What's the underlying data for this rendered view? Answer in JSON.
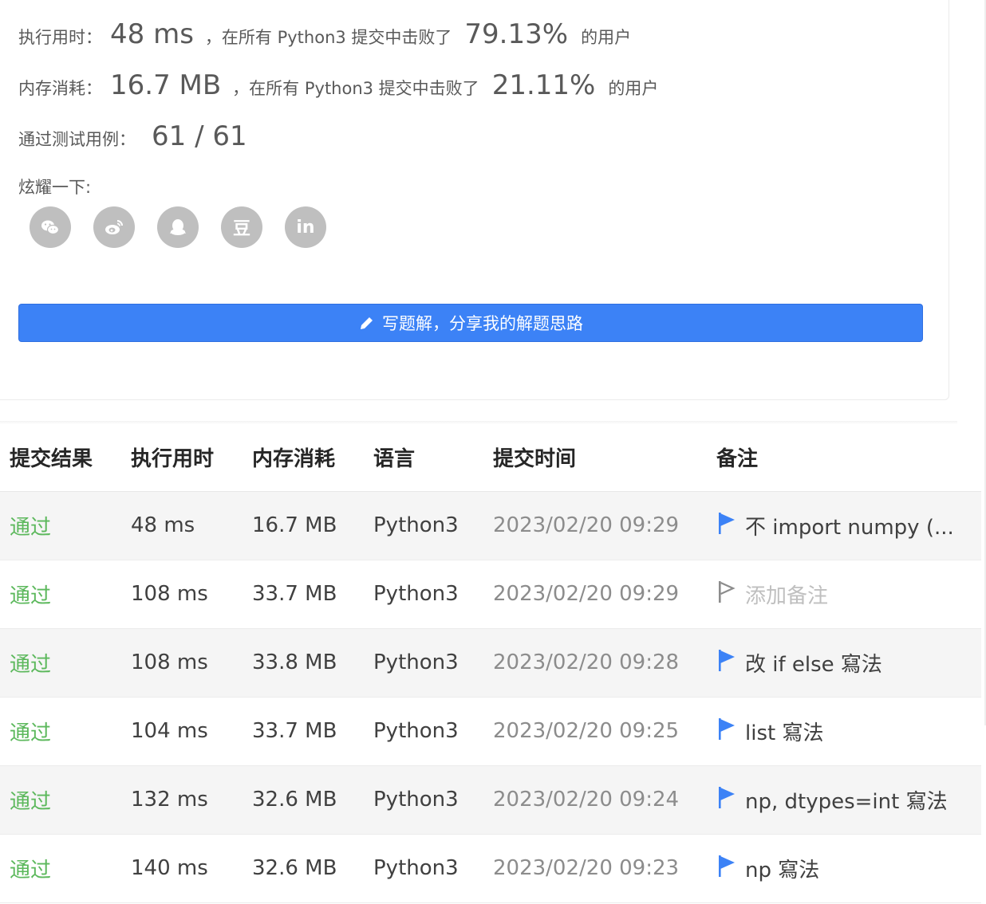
{
  "result": {
    "runtime_label": "执行用时：",
    "runtime_value": "48 ms",
    "runtime_prefix": "，在所有 Python3 提交中击败了",
    "runtime_pct": "79.13%",
    "runtime_suffix": "的用户",
    "memory_label": "内存消耗：",
    "memory_value": "16.7 MB",
    "memory_prefix": "，在所有 Python3 提交中击败了",
    "memory_pct": "21.11%",
    "memory_suffix": "的用户",
    "tests_label": "通过测试用例：",
    "tests_value": "61 / 61"
  },
  "share": {
    "label": "炫耀一下:",
    "icons": [
      "wechat-icon",
      "weibo-icon",
      "qq-icon",
      "douban-icon",
      "linkedin-icon"
    ],
    "douban_glyph": "豆",
    "linkedin_glyph": "in"
  },
  "write_button": {
    "label": "写题解，分享我的解题思路",
    "color": "#3c82f6"
  },
  "table": {
    "headers": [
      "提交结果",
      "执行用时",
      "内存消耗",
      "语言",
      "提交时间",
      "备注"
    ],
    "rows": [
      {
        "status": "通过",
        "runtime": "48 ms",
        "memory": "16.7 MB",
        "lang": "Python3",
        "time": "2023/02/20 09:29",
        "note": "不 import numpy (...",
        "flag": "filled"
      },
      {
        "status": "通过",
        "runtime": "108 ms",
        "memory": "33.7 MB",
        "lang": "Python3",
        "time": "2023/02/20 09:29",
        "note": "添加备注",
        "flag": "outline"
      },
      {
        "status": "通过",
        "runtime": "108 ms",
        "memory": "33.8 MB",
        "lang": "Python3",
        "time": "2023/02/20 09:28",
        "note": "改 if else 寫法",
        "flag": "filled"
      },
      {
        "status": "通过",
        "runtime": "104 ms",
        "memory": "33.7 MB",
        "lang": "Python3",
        "time": "2023/02/20 09:25",
        "note": "list 寫法",
        "flag": "filled"
      },
      {
        "status": "通过",
        "runtime": "132 ms",
        "memory": "32.6 MB",
        "lang": "Python3",
        "time": "2023/02/20 09:24",
        "note": "np, dtypes=int 寫法",
        "flag": "filled"
      },
      {
        "status": "通过",
        "runtime": "140 ms",
        "memory": "32.6 MB",
        "lang": "Python3",
        "time": "2023/02/20 09:23",
        "note": "np 寫法",
        "flag": "filled"
      }
    ]
  },
  "colors": {
    "pass_green": "#5cb85c",
    "flag_blue": "#3c82f6",
    "flag_gray": "#8c8c8c"
  }
}
